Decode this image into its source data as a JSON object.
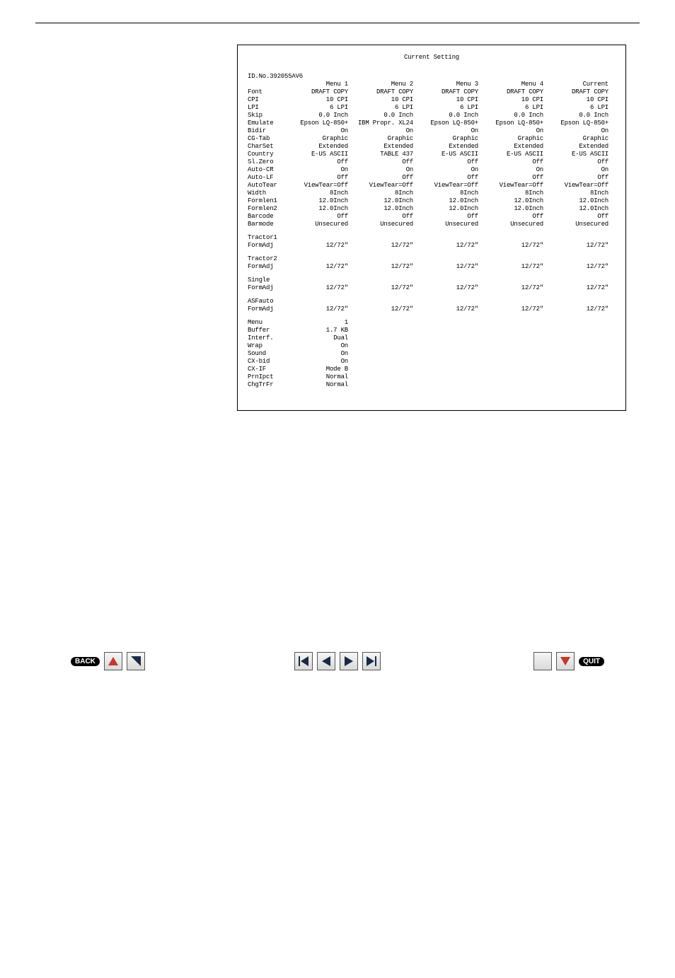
{
  "printout": {
    "title": "Current Setting",
    "id_line": "ID.No.392055AV6",
    "columns": [
      "",
      "Menu 1",
      "Menu 2",
      "Menu 3",
      "Menu 4",
      "Current"
    ],
    "rows": [
      {
        "label": "Font",
        "v": [
          "DRAFT COPY",
          "DRAFT COPY",
          "DRAFT COPY",
          "DRAFT COPY",
          "DRAFT COPY"
        ]
      },
      {
        "label": "CPI",
        "v": [
          "10 CPI",
          "10 CPI",
          "10 CPI",
          "10 CPI",
          "10 CPI"
        ]
      },
      {
        "label": "LPI",
        "v": [
          "6 LPI",
          "6 LPI",
          "6 LPI",
          "6 LPI",
          "6 LPI"
        ]
      },
      {
        "label": "Skip",
        "v": [
          "0.0 Inch",
          "0.0 Inch",
          "0.0 Inch",
          "0.0 Inch",
          "0.0 Inch"
        ]
      },
      {
        "label": "Emulate",
        "v": [
          "Epson LQ-850+",
          "IBM Propr. XL24",
          "Epson LQ-850+",
          "Epson LQ-850+",
          "Epson LQ-850+"
        ]
      },
      {
        "label": "Bidir",
        "v": [
          "On",
          "On",
          "On",
          "On",
          "On"
        ]
      },
      {
        "label": "CG-Tab",
        "v": [
          "Graphic",
          "Graphic",
          "Graphic",
          "Graphic",
          "Graphic"
        ]
      },
      {
        "label": "CharSet",
        "v": [
          "Extended",
          "Extended",
          "Extended",
          "Extended",
          "Extended"
        ]
      },
      {
        "label": "Country",
        "v": [
          "E-US ASCII",
          "TABLE 437",
          "E-US ASCII",
          "E-US ASCII",
          "E-US ASCII"
        ]
      },
      {
        "label": "Sl.Zero",
        "v": [
          "Off",
          "Off",
          "Off",
          "Off",
          "Off"
        ]
      },
      {
        "label": "Auto-CR",
        "v": [
          "On",
          "On",
          "On",
          "On",
          "On"
        ]
      },
      {
        "label": "Auto-LF",
        "v": [
          "Off",
          "Off",
          "Off",
          "Off",
          "Off"
        ]
      },
      {
        "label": "AutoTear",
        "v": [
          "ViewTear=Off",
          "ViewTear=Off",
          "ViewTear=Off",
          "ViewTear=Off",
          "ViewTear=Off"
        ]
      },
      {
        "label": "Width",
        "v": [
          "8Inch",
          "8Inch",
          "8Inch",
          "8Inch",
          "8Inch"
        ]
      },
      {
        "label": "Formlen1",
        "v": [
          "12.0Inch",
          "12.0Inch",
          "12.0Inch",
          "12.0Inch",
          "12.0Inch"
        ]
      },
      {
        "label": "Formlen2",
        "v": [
          "12.0Inch",
          "12.0Inch",
          "12.0Inch",
          "12.0Inch",
          "12.0Inch"
        ]
      },
      {
        "label": "Barcode",
        "v": [
          "Off",
          "Off",
          "Off",
          "Off",
          "Off"
        ]
      },
      {
        "label": "Barmode",
        "v": [
          "Unsecured",
          "Unsecured",
          "Unsecured",
          "Unsecured",
          "Unsecured"
        ]
      }
    ],
    "sections": [
      {
        "header": "Tractor1",
        "label": "FormAdj",
        "v": [
          "12/72\"",
          "12/72\"",
          "12/72\"",
          "12/72\"",
          "12/72\""
        ]
      },
      {
        "header": "Tractor2",
        "label": "FormAdj",
        "v": [
          "12/72\"",
          "12/72\"",
          "12/72\"",
          "12/72\"",
          "12/72\""
        ]
      },
      {
        "header": "Single",
        "label": "FormAdj",
        "v": [
          "12/72\"",
          "12/72\"",
          "12/72\"",
          "12/72\"",
          "12/72\""
        ]
      },
      {
        "header": "ASFauto",
        "label": "FormAdj",
        "v": [
          "12/72\"",
          "12/72\"",
          "12/72\"",
          "12/72\"",
          "12/72\""
        ]
      }
    ],
    "footer_rows": [
      {
        "label": "Menu",
        "value": "1"
      },
      {
        "label": "Buffer",
        "value": "1.7 KB"
      },
      {
        "label": "Interf.",
        "value": "Dual"
      },
      {
        "label": "Wrap",
        "value": "On"
      },
      {
        "label": "Sound",
        "value": "On"
      },
      {
        "label": "CX-bid",
        "value": "On"
      },
      {
        "label": "CX-IF",
        "value": "Mode B"
      },
      {
        "label": "PrnIpct",
        "value": "Normal"
      },
      {
        "label": "ChgTrFr",
        "value": "Normal"
      }
    ]
  },
  "nav": {
    "back_label": "BACK",
    "quit_label": "QUIT"
  }
}
